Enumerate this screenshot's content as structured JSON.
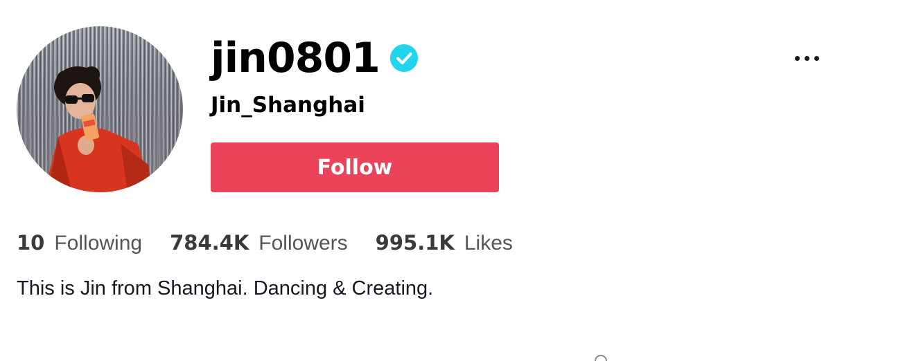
{
  "profile": {
    "username": "jin0801",
    "nickname": "Jin_Shanghai",
    "verified": true,
    "avatar_icon": "profile-photo",
    "follow_label": "Follow",
    "bio": "This is Jin from Shanghai. Dancing & Creating."
  },
  "stats": [
    {
      "value": "10",
      "label": "Following"
    },
    {
      "value": "784.4K",
      "label": "Followers"
    },
    {
      "value": "995.1K",
      "label": "Likes"
    }
  ],
  "icons": {
    "verified": "verified-check-icon",
    "more": "more-options-icon"
  },
  "colors": {
    "follow_button": "#ea435a",
    "verified_badge": "#20d5ec",
    "text_primary": "#161823"
  }
}
